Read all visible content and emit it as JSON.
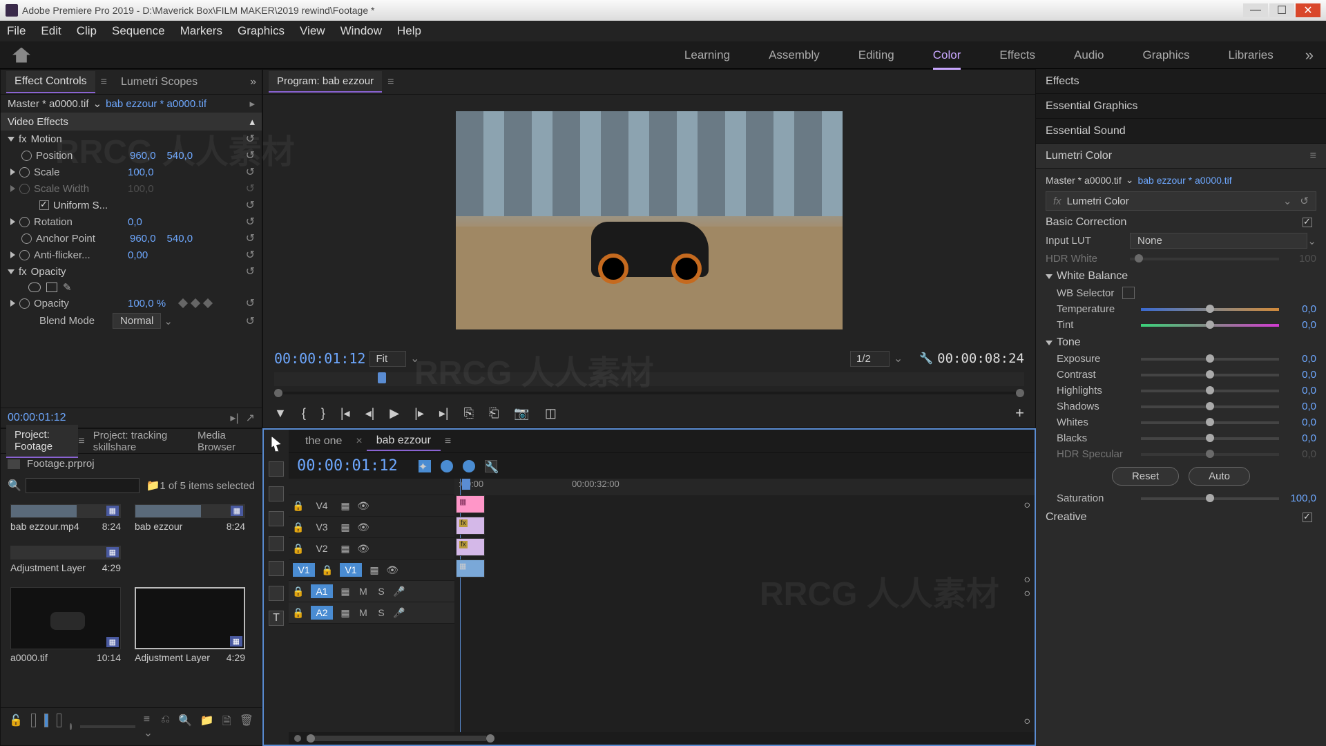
{
  "app": {
    "title": "Adobe Premiere Pro 2019 - D:\\Maverick Box\\FILM MAKER\\2019 rewind\\Footage *"
  },
  "menu": [
    "File",
    "Edit",
    "Clip",
    "Sequence",
    "Markers",
    "Graphics",
    "View",
    "Window",
    "Help"
  ],
  "workspaces": [
    "Learning",
    "Assembly",
    "Editing",
    "Color",
    "Effects",
    "Audio",
    "Graphics",
    "Libraries"
  ],
  "active_workspace": "Color",
  "effect_controls": {
    "tabs": [
      "Effect Controls",
      "Lumetri Scopes"
    ],
    "master": "Master * a0000.tif",
    "clip": "bab ezzour * a0000.tif",
    "video_effects": "Video Effects",
    "motion": {
      "label": "Motion",
      "position": {
        "lbl": "Position",
        "x": "960,0",
        "y": "540,0"
      },
      "scale": {
        "lbl": "Scale",
        "v": "100,0"
      },
      "scale_width": {
        "lbl": "Scale Width",
        "v": "100,0"
      },
      "uniform": "Uniform S...",
      "rotation": {
        "lbl": "Rotation",
        "v": "0,0"
      },
      "anchor": {
        "lbl": "Anchor Point",
        "x": "960,0",
        "y": "540,0"
      },
      "antiflicker": {
        "lbl": "Anti-flicker...",
        "v": "0,00"
      }
    },
    "opacity": {
      "label": "Opacity",
      "value": "100,0 %",
      "blend": {
        "lbl": "Blend Mode",
        "v": "Normal"
      }
    },
    "footer_tc": "00:00:01:12"
  },
  "program": {
    "title": "Program: bab ezzour",
    "tc": "00:00:01:12",
    "fit": "Fit",
    "res": "1/2",
    "dur": "00:00:08:24"
  },
  "project": {
    "tabs": [
      "Project: Footage",
      "Project: tracking skillshare",
      "Media Browser"
    ],
    "filename": "Footage.prproj",
    "count": "1 of 5 items selected",
    "items": [
      {
        "name": "bab ezzour.mp4",
        "dur": "8:24"
      },
      {
        "name": "bab ezzour",
        "dur": "8:24"
      },
      {
        "name": "Adjustment Layer",
        "dur": "4:29"
      },
      {
        "name": "a0000.tif",
        "dur": "10:14"
      },
      {
        "name": "Adjustment Layer",
        "dur": "4:29"
      }
    ]
  },
  "timeline": {
    "tabs": [
      {
        "label": "the one"
      },
      {
        "label": "bab ezzour"
      }
    ],
    "tc": "00:00:01:12",
    "ruler": [
      ":00:00",
      "00:00:32:00"
    ],
    "tracks": {
      "v": [
        "V4",
        "V3",
        "V2",
        "V1"
      ],
      "v1src": "V1",
      "a": [
        "A1",
        "A2"
      ],
      "a1src": "A1",
      "mute": "M",
      "solo": "S"
    }
  },
  "right": {
    "tabs": [
      "Effects",
      "Essential Graphics",
      "Essential Sound",
      "Lumetri Color"
    ],
    "active": "Lumetri Color",
    "master": "Master * a0000.tif",
    "clip": "bab ezzour * a0000.tif",
    "effect_name": "Lumetri Color",
    "basic": "Basic Correction",
    "input_lut": {
      "lbl": "Input LUT",
      "v": "None"
    },
    "hdr_white": {
      "lbl": "HDR White",
      "v": "100"
    },
    "wb": {
      "hdr": "White Balance",
      "sel": "WB Selector",
      "temp": {
        "lbl": "Temperature",
        "v": "0,0"
      },
      "tint": {
        "lbl": "Tint",
        "v": "0,0"
      }
    },
    "tone": {
      "hdr": "Tone",
      "exposure": {
        "lbl": "Exposure",
        "v": "0,0"
      },
      "contrast": {
        "lbl": "Contrast",
        "v": "0,0"
      },
      "highlights": {
        "lbl": "Highlights",
        "v": "0,0"
      },
      "shadows": {
        "lbl": "Shadows",
        "v": "0,0"
      },
      "whites": {
        "lbl": "Whites",
        "v": "0,0"
      },
      "blacks": {
        "lbl": "Blacks",
        "v": "0,0"
      },
      "hdrspec": {
        "lbl": "HDR Specular",
        "v": "0,0"
      }
    },
    "reset": "Reset",
    "auto": "Auto",
    "saturation": {
      "lbl": "Saturation",
      "v": "100,0"
    },
    "creative": "Creative"
  },
  "watermark": "RRCG  人人素材"
}
